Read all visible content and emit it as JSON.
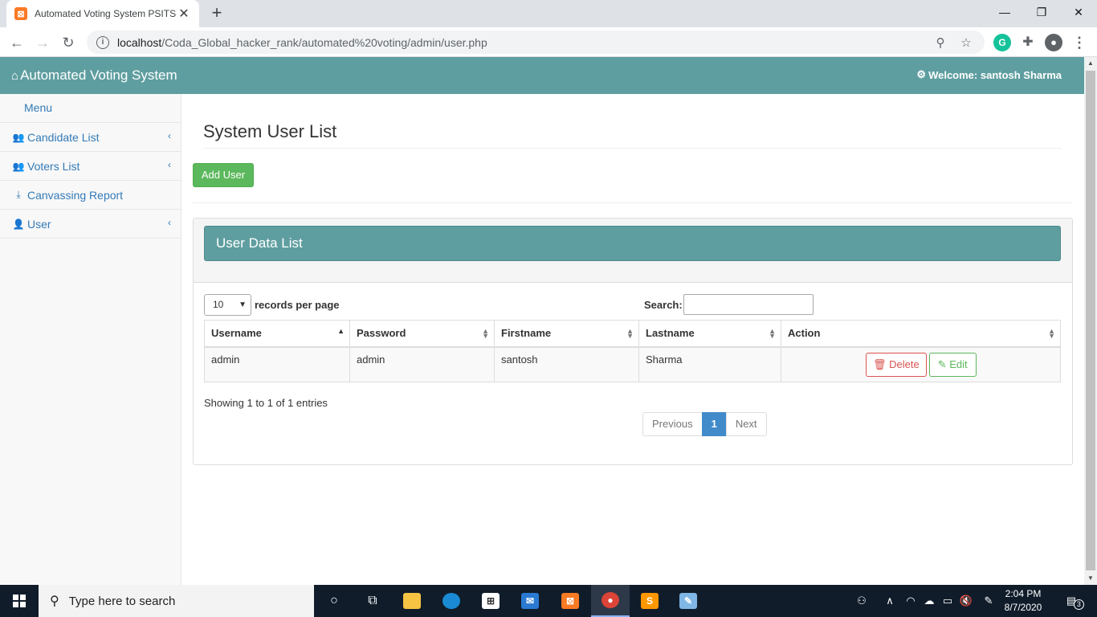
{
  "browser": {
    "tab_title": "Automated Voting System PSITS",
    "tab_favicon": "xampp-icon",
    "url_host": "localhost",
    "url_path": "/Coda_Global_hacker_rank/automated%20voting/admin/user.php"
  },
  "app": {
    "brand": "Automated Voting System",
    "welcome": "Welcome: santosh Sharma",
    "accent_color": "#5f9ea0"
  },
  "sidebar": {
    "menu_title": "Menu",
    "items": [
      {
        "label": "Candidate List",
        "icon": "users-icon",
        "has_chevron": true
      },
      {
        "label": "Voters List",
        "icon": "users-icon",
        "has_chevron": true
      },
      {
        "label": "Canvassing Report",
        "icon": "download-icon",
        "has_chevron": false
      },
      {
        "label": "User",
        "icon": "user-icon",
        "has_chevron": true
      }
    ]
  },
  "main": {
    "page_title": "System User List",
    "add_button": "Add User",
    "panel_title": "User Data List",
    "length_value": "10",
    "length_label": "records per page",
    "search_label": "Search:",
    "search_value": "",
    "columns": [
      "Username",
      "Password",
      "Firstname",
      "Lastname",
      "Action"
    ],
    "rows": [
      {
        "username": "admin",
        "password": "admin",
        "firstname": "santosh",
        "lastname": "Sharma"
      }
    ],
    "delete_label": "Delete",
    "edit_label": "Edit",
    "info": "Showing 1 to 1 of 1 entries",
    "pagination": {
      "previous": "Previous",
      "current": "1",
      "next": "Next"
    }
  },
  "taskbar": {
    "search_placeholder": "Type here to search",
    "time": "2:04 PM",
    "date": "8/7/2020",
    "notifications": "3"
  }
}
